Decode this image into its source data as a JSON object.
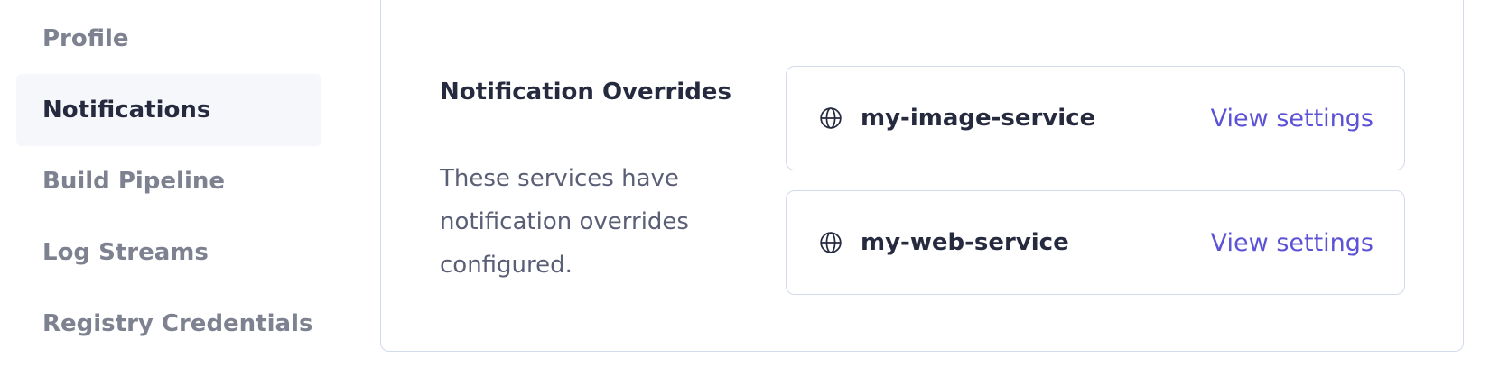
{
  "sidebar": {
    "items": [
      {
        "label": "Profile",
        "active": false
      },
      {
        "label": "Notifications",
        "active": true
      },
      {
        "label": "Build Pipeline",
        "active": false
      },
      {
        "label": "Log Streams",
        "active": false
      },
      {
        "label": "Registry Credentials",
        "active": false
      }
    ]
  },
  "overrides": {
    "title": "Notification Overrides",
    "description": "These services have notification overrides configured.",
    "services": [
      {
        "name": "my-image-service",
        "icon": "globe-icon",
        "link_label": "View settings"
      },
      {
        "name": "my-web-service",
        "icon": "globe-icon",
        "link_label": "View settings"
      }
    ]
  },
  "colors": {
    "accent_link": "#5c52d6",
    "active_nav_bg": "#f6f7fb",
    "border": "#d3dbea"
  }
}
